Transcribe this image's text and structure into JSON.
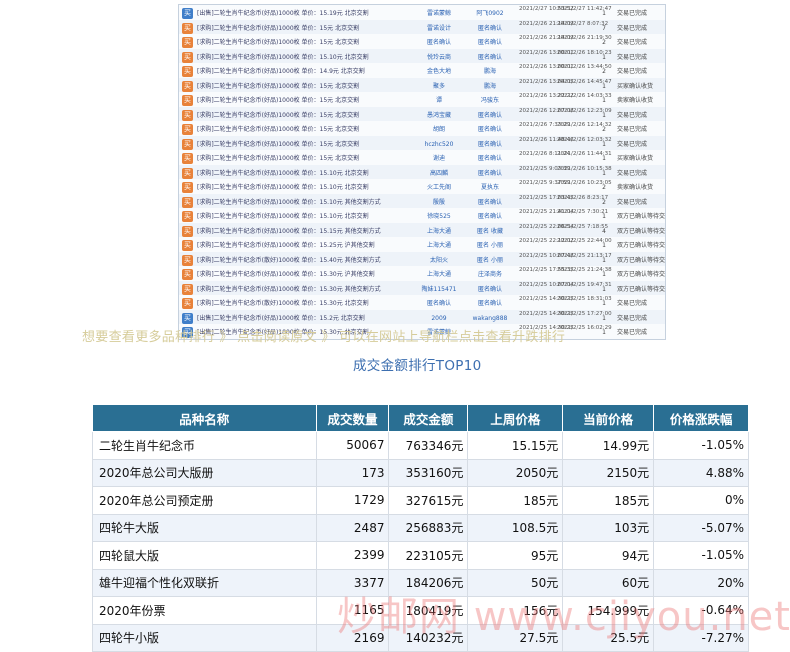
{
  "transactions": [
    {
      "title": "[出售]二轮生肖牛纪念币(好品)1000枚 单价：15.19元 北京交割",
      "seller": "雷诺蒙鲸",
      "buyer": "阿飞0902",
      "t1": "2021/2/27 10:53:52",
      "t2": "2021/2/27 11:42:47",
      "num": "1",
      "status": "交易已完成",
      "icon": "blue"
    },
    {
      "title": "[求购]二轮生肖牛纪念币(好品)1000枚 单价：15元 北京交割",
      "seller": "雷诺设计",
      "buyer": "匿名确认",
      "t1": "2021/2/26 21:14:09",
      "t2": "2021/2/27 8:07:32",
      "num": "7",
      "status": "交易已完成",
      "icon": "orange"
    },
    {
      "title": "[求购]二轮生肖牛纪念币(好品)1000枚 单价：15元 北京交割",
      "seller": "匿名确认",
      "buyer": "匿名确认",
      "t1": "2021/2/26 21:14:09",
      "t2": "2021/2/26 21:19:30",
      "num": "2",
      "status": "交易已完成",
      "icon": "orange"
    },
    {
      "title": "[求购]二轮生肖牛纪念币(好品)1000枚 单价：15.10元 北京交割",
      "seller": "悦玲云商",
      "buyer": "匿名确认",
      "t1": "2021/2/26 13:00:01",
      "t2": "2021/2/26 18:10:23",
      "num": "1",
      "status": "交易已完成",
      "icon": "orange"
    },
    {
      "title": "[求购]二轮生肖牛纪念币(好品)1000枚 单价：14.9元 北京交割",
      "seller": "金色大地",
      "buyer": "鹏海",
      "t1": "2021/2/26 13:00:01",
      "t2": "2021/2/26 13:44:50",
      "num": "2",
      "status": "交易已完成",
      "icon": "orange"
    },
    {
      "title": "[求购]二轮生肖牛纪念币(好品)1000枚 单价：15元 北京交割",
      "seller": "聚多",
      "buyer": "鹏海",
      "t1": "2021/2/26 13:04:05",
      "t2": "2021/2/26 14:45:47",
      "num": "1",
      "status": "买家确认收货",
      "icon": "orange"
    },
    {
      "title": "[求购]二轮生肖牛纪念币(好品)1000枚 单价：15元 北京交割",
      "seller": "谭",
      "buyer": "冯骏东",
      "t1": "2021/2/26 13:22:22",
      "t2": "2021/2/26 14:03:33",
      "num": "1",
      "status": "卖家确认收货",
      "icon": "orange"
    },
    {
      "title": "[求购]二轮生肖牛纪念币(好品)1000枚 单价：15元 北京交割",
      "seller": "愚鸿宝藏",
      "buyer": "匿名确认",
      "t1": "2021/2/26 12:07:08",
      "t2": "2021/2/26 12:23:09",
      "num": "1",
      "status": "交易已完成",
      "icon": "orange"
    },
    {
      "title": "[求购]二轮生肖牛纪念币(好品)1000枚 单价：15元 北京交割",
      "seller": "胡朗",
      "buyer": "匿名确认",
      "t1": "2021/2/26 7:33:29",
      "t2": "2021/2/26 12:14:32",
      "num": "2",
      "status": "交易已完成",
      "icon": "orange"
    },
    {
      "title": "[求购]二轮生肖牛纪念币(好品)1000枚 单价：15元 北京交割",
      "seller": "hczhc520",
      "buyer": "匿名确认",
      "t1": "2021/2/26 11:48:46",
      "t2": "2021/2/26 12:03:32",
      "num": "1",
      "status": "交易已完成",
      "icon": "orange"
    },
    {
      "title": "[求购]二轮生肖牛纪念币(好品)1000枚 单价：15元 北京交割",
      "seller": "谢迪",
      "buyer": "匿名确认",
      "t1": "2021/2/26 8:11:24",
      "t2": "2021/2/26 11:44:31",
      "num": "1",
      "status": "买家确认收货",
      "icon": "orange"
    },
    {
      "title": "[求购]二轮生肖牛纪念币(好品)1000枚 单价：15.10元 北京交割",
      "seller": "高四麟",
      "buyer": "匿名确认",
      "t1": "2021/2/25 9:03:39",
      "t2": "2021/2/26 10:15:38",
      "num": "1",
      "status": "交易已完成",
      "icon": "orange"
    },
    {
      "title": "[求购]二轮生肖牛纪念币(好品)1000枚 单价：15.10元 北京交割",
      "seller": "火工先阁",
      "buyer": "夏执东",
      "t1": "2021/2/25 9:37:59",
      "t2": "2021/2/26 10:23:05",
      "num": "2",
      "status": "卖家确认收货",
      "icon": "orange"
    },
    {
      "title": "[求购]二轮生肖牛纪念币(好品)1000枚 单价：15.10元 其他交割方式",
      "seller": "殷殷",
      "buyer": "匿名确认",
      "t1": "2021/2/25 17:03:45",
      "t2": "2021/2/26 8:23:17",
      "num": "2",
      "status": "交易已完成",
      "icon": "orange"
    },
    {
      "title": "[求购]二轮生肖牛纪念币(好品)1000枚 单价：15.10元 北京交割",
      "seller": "徐晓525",
      "buyer": "匿名确认",
      "t1": "2021/2/25 21:41:04",
      "t2": "2021/2/25 7:30:21",
      "num": "1",
      "status": "双方已确认等待交割",
      "icon": "orange"
    },
    {
      "title": "[求购]二轮生肖牛纪念币(好品)1000枚 单价：15.15元 其他交割方式",
      "seller": "上海大通",
      "buyer": "匿名 收藏",
      "t1": "2021/2/25 22:06:54",
      "t2": "2021/2/25 7:18:55",
      "num": "4",
      "status": "双方已确认等待交割",
      "icon": "orange"
    },
    {
      "title": "[求购]二轮生肖牛纪念币(好品)1000枚 单价：15.25元 沪其他交割",
      "seller": "上海大通",
      "buyer": "匿名 小丽",
      "t1": "2021/2/25 22:12:02",
      "t2": "2021/2/25 22:44:00",
      "num": "1",
      "status": "双方已确认等待交割",
      "icon": "orange"
    },
    {
      "title": "[求购]二轮生肖牛纪念币(散好)1000枚 单价：15.40元 其他交割方式",
      "seller": "太阳火",
      "buyer": "匿名 小丽",
      "t1": "2021/2/25 10:07:48",
      "t2": "2021/2/25 21:13:17",
      "num": "1",
      "status": "双方已确认等待交割",
      "icon": "orange"
    },
    {
      "title": "[求购]二轮生肖牛纪念币(好品)1000枚 单价：15.30元 沪其他交割",
      "seller": "上海大通",
      "buyer": "庄泽商务",
      "t1": "2021/2/25 17:55:35",
      "t2": "2021/2/25 21:24:38",
      "num": "1",
      "status": "双方已确认等待交割",
      "icon": "orange"
    },
    {
      "title": "[求购]二轮生肖牛纪念币(好品)1000枚 单价：15.30元 其他交割方式",
      "seller": "陶妹115471",
      "buyer": "匿名确认",
      "t1": "2021/2/25 10:07:04",
      "t2": "2021/2/25 19:47:31",
      "num": "1",
      "status": "双方已确认等待交割",
      "icon": "orange"
    },
    {
      "title": "[求购]二轮生肖牛纪念币(散好)1000枚 单价：15.30元 北京交割",
      "seller": "匿名确认",
      "buyer": "匿名确认",
      "t1": "2021/2/25 14:30:25",
      "t2": "2021/2/25 18:31:03",
      "num": "1",
      "status": "交易已完成",
      "icon": "orange"
    },
    {
      "title": "[出售]二轮生肖牛纪念币(好品)1000枚 单价：15.2元 北京交割",
      "seller": "2009",
      "buyer": "wakang888",
      "t1": "2021/2/25 14:30:25",
      "t2": "2021/2/25 17:27:00",
      "num": "1",
      "status": "交易已完成",
      "icon": "blue"
    },
    {
      "title": "[出售]二轮生肖牛纪念币(好品)1000枚 单价：15.30元 北京交割",
      "seller": "雷诺蒙鲸",
      "buyer": "",
      "t1": "2021/2/25 14:30:25",
      "t2": "2021/2/25 16:02:29",
      "num": "1",
      "status": "交易已完成",
      "icon": "blue"
    }
  ],
  "more_line": "想要查看更多品种排行 》 点击阅读原文 》 可以在网站上导航栏点击查看升跌排行",
  "table_title": "成交金额排行TOP10",
  "headers": [
    "品种名称",
    "成交数量",
    "成交金额",
    "上周价格",
    "当前价格",
    "价格涨跌幅"
  ],
  "rows": [
    {
      "name": "二轮生肖牛纪念币",
      "qty": "50067",
      "amount": "763346元",
      "last": "15.15元",
      "cur": "14.99元",
      "chg": "-1.05%",
      "dir": "neg"
    },
    {
      "name": "2020年总公司大版册",
      "qty": "173",
      "amount": "353160元",
      "last": "2050元",
      "cur": "2150元",
      "chg": "4.88%",
      "dir": "pos"
    },
    {
      "name": "2020年总公司预定册",
      "qty": "1729",
      "amount": "327615元",
      "last": "185元",
      "cur": "185元",
      "chg": "0%",
      "dir": "flat"
    },
    {
      "name": "四轮牛大版",
      "qty": "2487",
      "amount": "256883元",
      "last": "108.5元",
      "cur": "103元",
      "chg": "-5.07%",
      "dir": "neg"
    },
    {
      "name": "四轮鼠大版",
      "qty": "2399",
      "amount": "223105元",
      "last": "95元",
      "cur": "94元",
      "chg": "-1.05%",
      "dir": "neg"
    },
    {
      "name": "雄牛迎福个性化双联折",
      "qty": "3377",
      "amount": "184206元",
      "last": "50元",
      "cur": "60元",
      "chg": "20%",
      "dir": "pos"
    },
    {
      "name": "2020年份票",
      "qty": "1165",
      "amount": "180419元",
      "last": "156元",
      "cur": "154.999元",
      "chg": "-0.64%",
      "dir": "neg"
    },
    {
      "name": "四轮牛小版",
      "qty": "2169",
      "amount": "140232元",
      "last": "27.5元",
      "cur": "25.5元",
      "chg": "-7.27%",
      "dir": "neg"
    }
  ],
  "watermark": "炒邮网 www.cjiyou.net"
}
